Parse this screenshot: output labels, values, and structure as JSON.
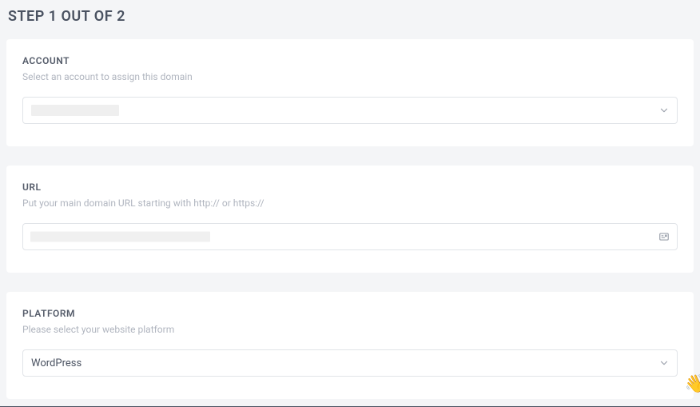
{
  "step_title": "STEP 1 OUT OF 2",
  "account": {
    "label": "ACCOUNT",
    "description": "Select an account to assign this domain",
    "value": ""
  },
  "url": {
    "label": "URL",
    "description": "Put your main domain URL starting with http:// or https://",
    "value": ""
  },
  "platform": {
    "label": "PLATFORM",
    "description": "Please select your website platform",
    "value": "WordPress"
  }
}
